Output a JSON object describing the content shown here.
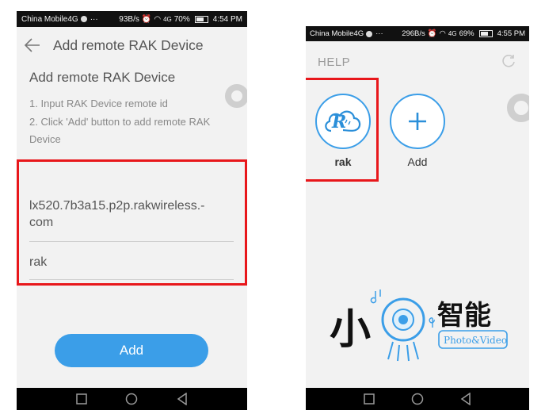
{
  "left_phone": {
    "status": {
      "carrier": "China Mobile4G",
      "net_speed": "93B/s",
      "signal": "4G",
      "battery": "70%",
      "time": "4:54 PM"
    },
    "header": {
      "title": "Add remote RAK Device",
      "back_icon": "arrow-left-icon"
    },
    "section_title": "Add remote RAK Device",
    "instructions": [
      "1. Input RAK Device remote id",
      "2. Click 'Add' button to add remote RAK Device"
    ],
    "fields": {
      "remote_id_line1": "lx520.7b3a15.p2p.rakwireless.-",
      "remote_id_line2": "com",
      "name": "rak"
    },
    "add_button": "Add",
    "highlight_color": "#e8171b",
    "accent_color": "#3b9ee8"
  },
  "right_phone": {
    "status": {
      "carrier": "China Mobile4G",
      "net_speed": "296B/s",
      "signal": "4G",
      "battery": "69%",
      "time": "4:55 PM"
    },
    "help": "HELP",
    "devices": [
      {
        "label": "rak",
        "icon": "rak-cloud-icon"
      }
    ],
    "add_label": "Add",
    "logo": {
      "text_main": "小",
      "text_side": "智能",
      "badge": "Photo&Video"
    }
  },
  "nav_icons": [
    "square-recent-icon",
    "circle-home-icon",
    "triangle-back-icon"
  ]
}
